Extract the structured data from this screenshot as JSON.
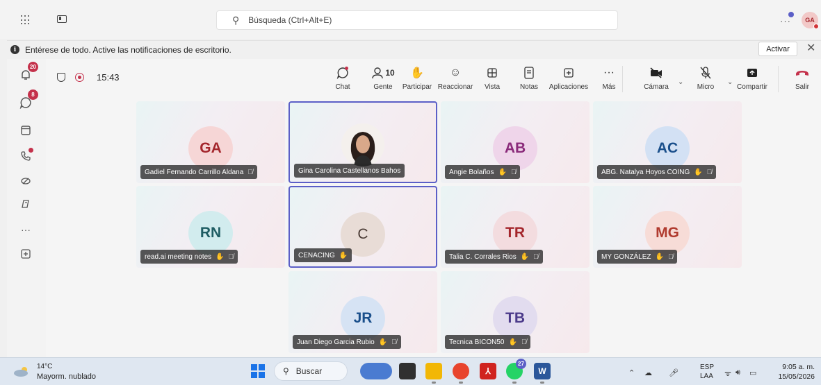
{
  "app": {
    "search_placeholder": "Búsqueda (Ctrl+Alt+E)",
    "user_initials": "GA"
  },
  "notification": {
    "text": "Entérese de todo. Active las notificaciones de escritorio.",
    "activate_label": "Activar"
  },
  "rail": {
    "activity_badge": "20",
    "chat_badge": "8"
  },
  "meeting": {
    "timer": "15:43",
    "participants_count": "10",
    "toolbar": {
      "chat": "Chat",
      "people": "Gente",
      "raise_hand": "Participar",
      "react": "Reaccionar",
      "view": "Vista",
      "notes": "Notas",
      "apps": "Aplicaciones",
      "more": "Más",
      "camera": "Cámara",
      "mic": "Micro",
      "share": "Compartir",
      "leave": "Salir"
    },
    "participants": [
      {
        "initials": "GA",
        "name": "Gadiel Fernando Carrillo Aldana",
        "avatar_bg": "#f6d6d6",
        "avatar_fg": "#a4262c",
        "hand": false,
        "muted": true,
        "selected": false
      },
      {
        "initials": "",
        "name": "Gina Carolina Castellanos Bahos",
        "avatar_bg": "#f4f0ed",
        "avatar_fg": "#333333",
        "hand": false,
        "muted": false,
        "selected": true,
        "photo": true
      },
      {
        "initials": "AB",
        "name": "Angie Bolaños",
        "avatar_bg": "#efd5ea",
        "avatar_fg": "#8a2a7a",
        "hand": true,
        "muted": true,
        "selected": false
      },
      {
        "initials": "AC",
        "name": "ABG. Natalya Hoyos COING",
        "avatar_bg": "#d3e1f4",
        "avatar_fg": "#1a4f8b",
        "hand": true,
        "muted": true,
        "selected": false
      },
      {
        "initials": "RN",
        "name": "read.ai meeting notes",
        "avatar_bg": "#d2ecee",
        "avatar_fg": "#1f5d63",
        "hand": true,
        "muted": true,
        "selected": false
      },
      {
        "initials": "C",
        "name": "CENACING",
        "avatar_bg": "#e8dcd6",
        "avatar_fg": "#4a3b35",
        "hand": true,
        "muted": false,
        "selected": true
      },
      {
        "initials": "TR",
        "name": "Talia C. Corrales Rios",
        "avatar_bg": "#f3dcdf",
        "avatar_fg": "#a4262c",
        "hand": true,
        "muted": true,
        "selected": false
      },
      {
        "initials": "MG",
        "name": "MY GONZÁLEZ",
        "avatar_bg": "#f7dcd7",
        "avatar_fg": "#b03a2e",
        "hand": true,
        "muted": true,
        "selected": false
      },
      {
        "initials": "JR",
        "name": "Juan Diego Garcia Rubio",
        "avatar_bg": "#d6e3f4",
        "avatar_fg": "#1a4f8b",
        "hand": true,
        "muted": true,
        "selected": false
      },
      {
        "initials": "TB",
        "name": "Tecnica BICON50",
        "avatar_bg": "#e2dcef",
        "avatar_fg": "#4b3a8a",
        "hand": true,
        "muted": true,
        "selected": false
      }
    ]
  },
  "taskbar": {
    "temperature": "14°C",
    "weather": "Mayorm. nublado",
    "search_label": "Buscar",
    "whatsapp_badge": "27",
    "lang1": "ESP",
    "lang2": "LAA",
    "time": "9:05 a. m.",
    "date": "15/05/2026"
  },
  "colors": {
    "accent": "#5b5fc7",
    "leave_red": "#c4314b"
  }
}
